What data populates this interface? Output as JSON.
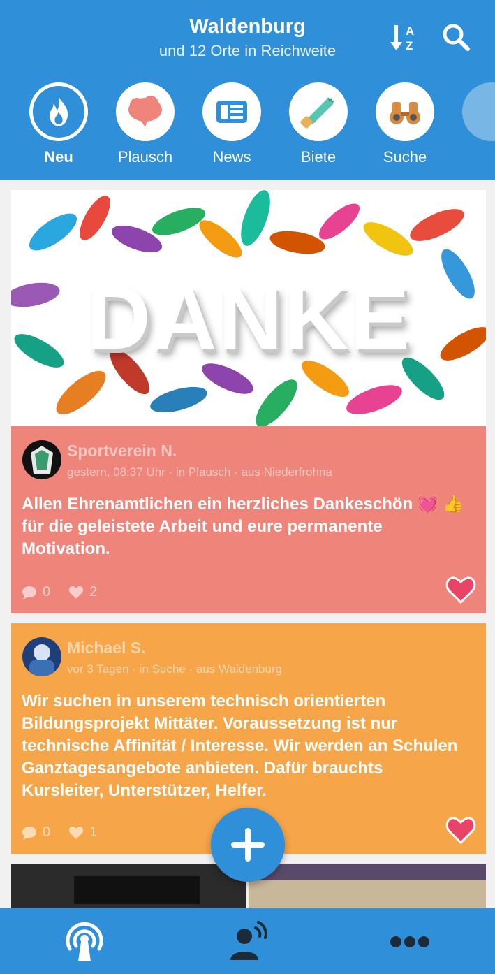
{
  "header": {
    "title": "Waldenburg",
    "subtitle": "und 12 Orte in Reichweite",
    "sort_icon": "sort-az-icon",
    "search_icon": "search-icon"
  },
  "categories": [
    {
      "label": "Neu",
      "icon": "flame-icon",
      "active": true
    },
    {
      "label": "Plausch",
      "icon": "chat-bubble-icon",
      "active": false
    },
    {
      "label": "News",
      "icon": "newspaper-icon",
      "active": false
    },
    {
      "label": "Biete",
      "icon": "saw-icon",
      "active": false
    },
    {
      "label": "Suche",
      "icon": "binoculars-icon",
      "active": false
    }
  ],
  "banner": {
    "text": "DANKE"
  },
  "posts": [
    {
      "author": "Sportverein N.",
      "meta": "gestern, 08:37 Uhr · in Plausch · aus Niederfrohna",
      "text": "Allen Ehrenamtlichen ein herzliches Dankeschön 💓 👍 für die geleistete Arbeit und eure permanente Motivation.",
      "comments": "0",
      "likes": "2",
      "color": "#ef847a"
    },
    {
      "author": "Michael S.",
      "meta": "vor 3 Tagen · in Suche · aus Waldenburg",
      "text": "Wir suchen in unserem technisch orientierten Bildungsprojekt Mittäter. Voraussetzung ist nur technische Affinität / Interesse. Wir werden an Schulen Ganztagesangebote anbieten. Dafür brauchts Kursleiter, Unterstützer, Helfer.",
      "comments": "0",
      "likes": "1",
      "color": "#f6a548"
    }
  ],
  "colors": {
    "primary": "#2f8fd8",
    "heart": "#e94468"
  },
  "bottom_nav": [
    "broadcast-icon",
    "user-signal-icon",
    "more-dots-icon"
  ]
}
